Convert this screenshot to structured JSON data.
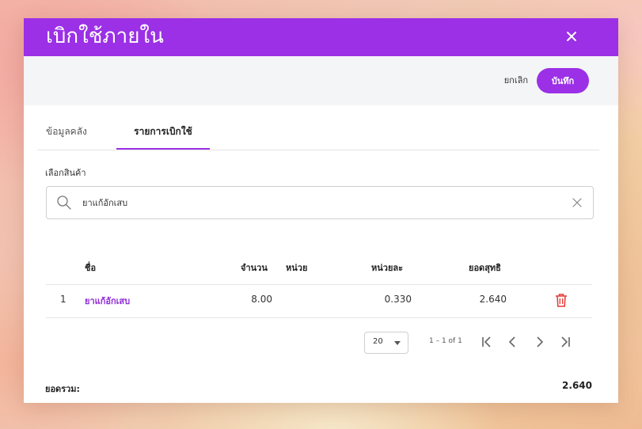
{
  "dialog": {
    "title": "เบิกใช้ภายใน",
    "close_icon": "close-icon"
  },
  "toolbar": {
    "cancel_label": "ยกเลิก",
    "save_label": "บันทึก"
  },
  "tabs": [
    {
      "label": "ข้อมูลคลัง",
      "active": false
    },
    {
      "label": "รายการเบิกใช้",
      "active": true
    }
  ],
  "product_field": {
    "label": "เลือกสินค้า",
    "value": "ยาแก้อักเสบ",
    "search_icon": "search-icon",
    "clear_icon": "close-icon"
  },
  "table": {
    "columns": [
      "ชื่อ",
      "จำนวน",
      "หน่วย",
      "หน่วยละ",
      "ยอดสุทธิ"
    ],
    "rows": [
      {
        "index": "1",
        "name": "ยาแก้อักเสบ",
        "qty": "8.00",
        "unit": "",
        "per_unit": "0.330",
        "net": "2.640",
        "action_icon": "trash-icon"
      }
    ]
  },
  "pagination": {
    "page_size": "20",
    "range": "1 – 1 of 1",
    "icons": [
      "first-page-icon",
      "prev-page-icon",
      "next-page-icon",
      "last-page-icon"
    ]
  },
  "summary": {
    "total_label": "ยอดรวม:",
    "total_value": "2.640"
  },
  "colors": {
    "accent": "#9b30e6",
    "danger": "#e53935",
    "toolbar_bg": "#f4f5f6"
  }
}
